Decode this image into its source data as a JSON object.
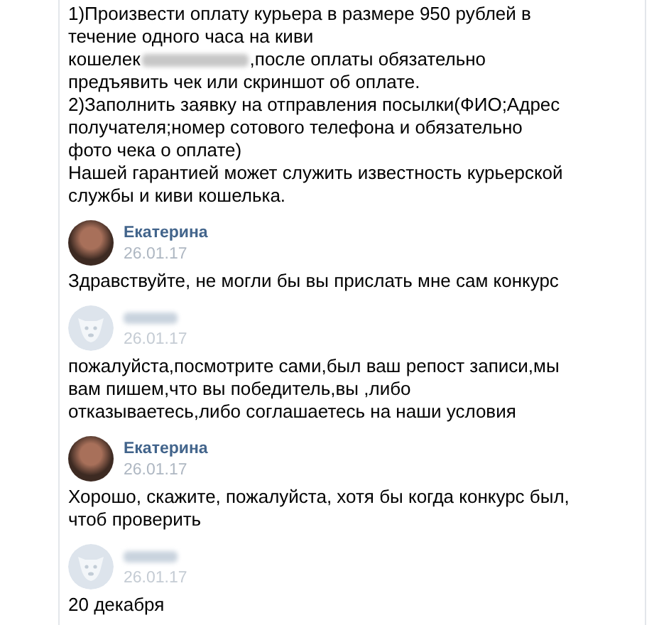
{
  "messages": [
    {
      "kind": "plain",
      "lines": [
        {
          "kind": "text",
          "text": "1)Произвести оплату курьера в размере 950 рублей в"
        },
        {
          "kind": "text",
          "text": "течение одного часа на киви"
        },
        {
          "kind": "redacted",
          "before": "кошелек",
          "after": ",после оплаты обязательно"
        },
        {
          "kind": "text",
          "text": "предъявить чек или скриншот об оплате."
        },
        {
          "kind": "text",
          "text": "2)Заполнить заявку на отправления посылки(ФИО;Адрес"
        },
        {
          "kind": "text",
          "text": "получателя;номер сотового телефона и обязательно"
        },
        {
          "kind": "text",
          "text": "фото чека о оплате)"
        },
        {
          "kind": "text",
          "text": "Нашей гарантией может служить известность курьерской"
        },
        {
          "kind": "text",
          "text": "службы и киви кошелька."
        }
      ]
    },
    {
      "kind": "named",
      "name": "Екатерина",
      "date": "26.01.17",
      "lines": [
        {
          "kind": "text",
          "text": "Здравствуйте, не могли бы вы прислать мне сам конкурс"
        }
      ]
    },
    {
      "kind": "hidden",
      "date": "26.01.17",
      "lines": [
        {
          "kind": "text",
          "text": "пожалуйста,посмотрите сами,был ваш репост записи,мы"
        },
        {
          "kind": "text",
          "text": "вам пишем,что вы победитель,вы ,либо"
        },
        {
          "kind": "text",
          "text": "отказываетесь,либо соглашаетесь на наши условия"
        }
      ]
    },
    {
      "kind": "named",
      "name": "Екатерина",
      "date": "26.01.17",
      "lines": [
        {
          "kind": "text",
          "text": "Хорошо, скажите, пожалуйста, хотя бы когда конкурс был,"
        },
        {
          "kind": "text",
          "text": "чтоб проверить"
        }
      ]
    },
    {
      "kind": "hidden",
      "date": "26.01.17",
      "lines": [
        {
          "kind": "text",
          "text": "20 декабря"
        }
      ]
    }
  ]
}
